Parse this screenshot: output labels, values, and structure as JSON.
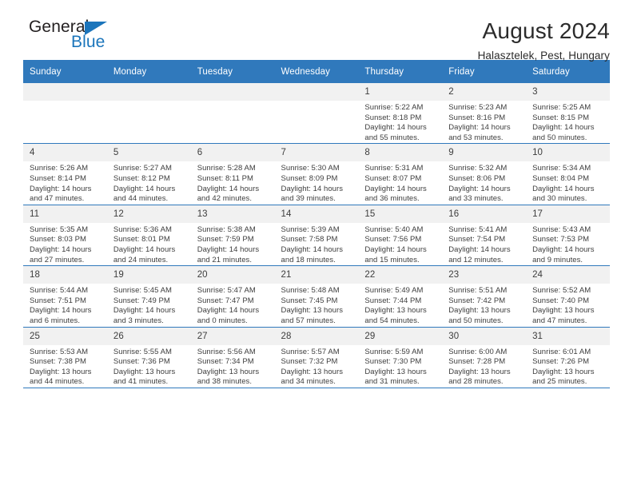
{
  "brand": {
    "name_part1": "General",
    "name_part2": "Blue",
    "accent_color": "#1b75bb"
  },
  "header": {
    "title": "August 2024",
    "subtitle": "Halasztelek, Pest, Hungary"
  },
  "theme": {
    "header_row_color": "#3079bc",
    "daynum_background": "#f1f1f1"
  },
  "weekday_headers": [
    "Sunday",
    "Monday",
    "Tuesday",
    "Wednesday",
    "Thursday",
    "Friday",
    "Saturday"
  ],
  "weeks": [
    [
      {
        "day": "",
        "empty": true
      },
      {
        "day": "",
        "empty": true
      },
      {
        "day": "",
        "empty": true
      },
      {
        "day": "",
        "empty": true
      },
      {
        "day": "1",
        "sunrise": "Sunrise: 5:22 AM",
        "sunset": "Sunset: 8:18 PM",
        "daylight1": "Daylight: 14 hours",
        "daylight2": "and 55 minutes."
      },
      {
        "day": "2",
        "sunrise": "Sunrise: 5:23 AM",
        "sunset": "Sunset: 8:16 PM",
        "daylight1": "Daylight: 14 hours",
        "daylight2": "and 53 minutes."
      },
      {
        "day": "3",
        "sunrise": "Sunrise: 5:25 AM",
        "sunset": "Sunset: 8:15 PM",
        "daylight1": "Daylight: 14 hours",
        "daylight2": "and 50 minutes."
      }
    ],
    [
      {
        "day": "4",
        "sunrise": "Sunrise: 5:26 AM",
        "sunset": "Sunset: 8:14 PM",
        "daylight1": "Daylight: 14 hours",
        "daylight2": "and 47 minutes."
      },
      {
        "day": "5",
        "sunrise": "Sunrise: 5:27 AM",
        "sunset": "Sunset: 8:12 PM",
        "daylight1": "Daylight: 14 hours",
        "daylight2": "and 44 minutes."
      },
      {
        "day": "6",
        "sunrise": "Sunrise: 5:28 AM",
        "sunset": "Sunset: 8:11 PM",
        "daylight1": "Daylight: 14 hours",
        "daylight2": "and 42 minutes."
      },
      {
        "day": "7",
        "sunrise": "Sunrise: 5:30 AM",
        "sunset": "Sunset: 8:09 PM",
        "daylight1": "Daylight: 14 hours",
        "daylight2": "and 39 minutes."
      },
      {
        "day": "8",
        "sunrise": "Sunrise: 5:31 AM",
        "sunset": "Sunset: 8:07 PM",
        "daylight1": "Daylight: 14 hours",
        "daylight2": "and 36 minutes."
      },
      {
        "day": "9",
        "sunrise": "Sunrise: 5:32 AM",
        "sunset": "Sunset: 8:06 PM",
        "daylight1": "Daylight: 14 hours",
        "daylight2": "and 33 minutes."
      },
      {
        "day": "10",
        "sunrise": "Sunrise: 5:34 AM",
        "sunset": "Sunset: 8:04 PM",
        "daylight1": "Daylight: 14 hours",
        "daylight2": "and 30 minutes."
      }
    ],
    [
      {
        "day": "11",
        "sunrise": "Sunrise: 5:35 AM",
        "sunset": "Sunset: 8:03 PM",
        "daylight1": "Daylight: 14 hours",
        "daylight2": "and 27 minutes."
      },
      {
        "day": "12",
        "sunrise": "Sunrise: 5:36 AM",
        "sunset": "Sunset: 8:01 PM",
        "daylight1": "Daylight: 14 hours",
        "daylight2": "and 24 minutes."
      },
      {
        "day": "13",
        "sunrise": "Sunrise: 5:38 AM",
        "sunset": "Sunset: 7:59 PM",
        "daylight1": "Daylight: 14 hours",
        "daylight2": "and 21 minutes."
      },
      {
        "day": "14",
        "sunrise": "Sunrise: 5:39 AM",
        "sunset": "Sunset: 7:58 PM",
        "daylight1": "Daylight: 14 hours",
        "daylight2": "and 18 minutes."
      },
      {
        "day": "15",
        "sunrise": "Sunrise: 5:40 AM",
        "sunset": "Sunset: 7:56 PM",
        "daylight1": "Daylight: 14 hours",
        "daylight2": "and 15 minutes."
      },
      {
        "day": "16",
        "sunrise": "Sunrise: 5:41 AM",
        "sunset": "Sunset: 7:54 PM",
        "daylight1": "Daylight: 14 hours",
        "daylight2": "and 12 minutes."
      },
      {
        "day": "17",
        "sunrise": "Sunrise: 5:43 AM",
        "sunset": "Sunset: 7:53 PM",
        "daylight1": "Daylight: 14 hours",
        "daylight2": "and 9 minutes."
      }
    ],
    [
      {
        "day": "18",
        "sunrise": "Sunrise: 5:44 AM",
        "sunset": "Sunset: 7:51 PM",
        "daylight1": "Daylight: 14 hours",
        "daylight2": "and 6 minutes."
      },
      {
        "day": "19",
        "sunrise": "Sunrise: 5:45 AM",
        "sunset": "Sunset: 7:49 PM",
        "daylight1": "Daylight: 14 hours",
        "daylight2": "and 3 minutes."
      },
      {
        "day": "20",
        "sunrise": "Sunrise: 5:47 AM",
        "sunset": "Sunset: 7:47 PM",
        "daylight1": "Daylight: 14 hours",
        "daylight2": "and 0 minutes."
      },
      {
        "day": "21",
        "sunrise": "Sunrise: 5:48 AM",
        "sunset": "Sunset: 7:45 PM",
        "daylight1": "Daylight: 13 hours",
        "daylight2": "and 57 minutes."
      },
      {
        "day": "22",
        "sunrise": "Sunrise: 5:49 AM",
        "sunset": "Sunset: 7:44 PM",
        "daylight1": "Daylight: 13 hours",
        "daylight2": "and 54 minutes."
      },
      {
        "day": "23",
        "sunrise": "Sunrise: 5:51 AM",
        "sunset": "Sunset: 7:42 PM",
        "daylight1": "Daylight: 13 hours",
        "daylight2": "and 50 minutes."
      },
      {
        "day": "24",
        "sunrise": "Sunrise: 5:52 AM",
        "sunset": "Sunset: 7:40 PM",
        "daylight1": "Daylight: 13 hours",
        "daylight2": "and 47 minutes."
      }
    ],
    [
      {
        "day": "25",
        "sunrise": "Sunrise: 5:53 AM",
        "sunset": "Sunset: 7:38 PM",
        "daylight1": "Daylight: 13 hours",
        "daylight2": "and 44 minutes."
      },
      {
        "day": "26",
        "sunrise": "Sunrise: 5:55 AM",
        "sunset": "Sunset: 7:36 PM",
        "daylight1": "Daylight: 13 hours",
        "daylight2": "and 41 minutes."
      },
      {
        "day": "27",
        "sunrise": "Sunrise: 5:56 AM",
        "sunset": "Sunset: 7:34 PM",
        "daylight1": "Daylight: 13 hours",
        "daylight2": "and 38 minutes."
      },
      {
        "day": "28",
        "sunrise": "Sunrise: 5:57 AM",
        "sunset": "Sunset: 7:32 PM",
        "daylight1": "Daylight: 13 hours",
        "daylight2": "and 34 minutes."
      },
      {
        "day": "29",
        "sunrise": "Sunrise: 5:59 AM",
        "sunset": "Sunset: 7:30 PM",
        "daylight1": "Daylight: 13 hours",
        "daylight2": "and 31 minutes."
      },
      {
        "day": "30",
        "sunrise": "Sunrise: 6:00 AM",
        "sunset": "Sunset: 7:28 PM",
        "daylight1": "Daylight: 13 hours",
        "daylight2": "and 28 minutes."
      },
      {
        "day": "31",
        "sunrise": "Sunrise: 6:01 AM",
        "sunset": "Sunset: 7:26 PM",
        "daylight1": "Daylight: 13 hours",
        "daylight2": "and 25 minutes."
      }
    ]
  ]
}
